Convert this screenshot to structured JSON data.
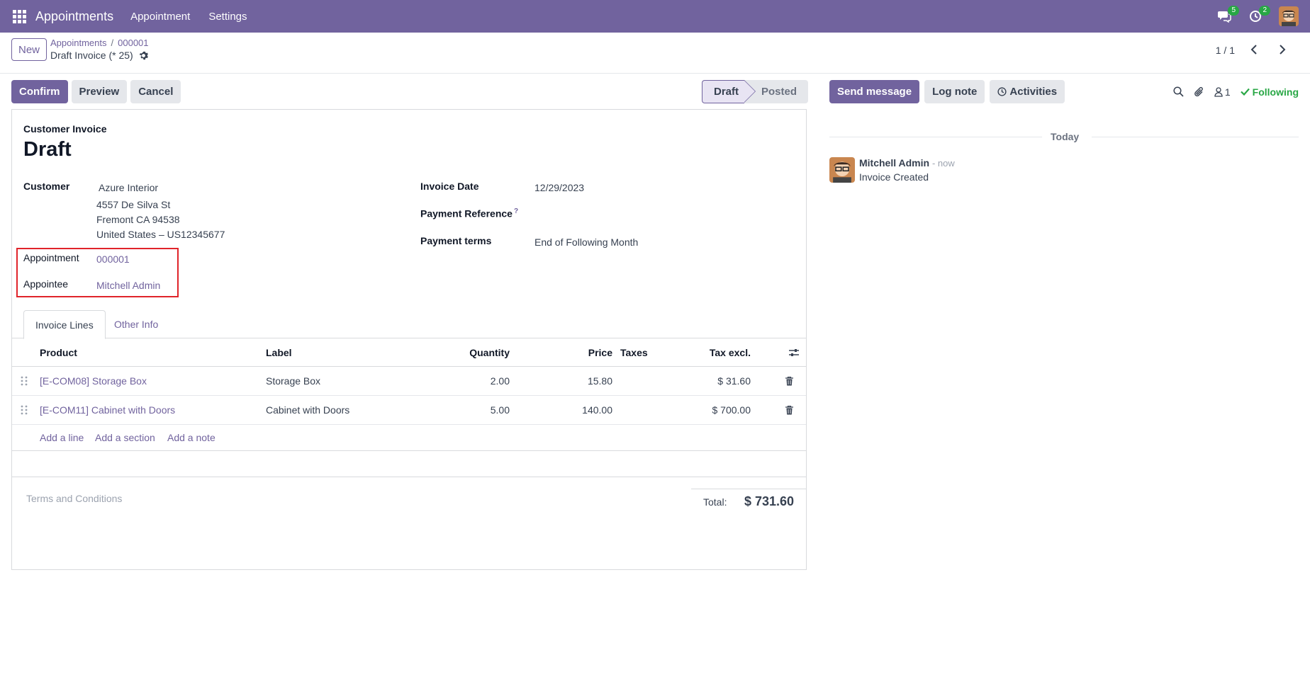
{
  "navbar": {
    "brand": "Appointments",
    "menu": [
      "Appointment",
      "Settings"
    ],
    "messages_badge": "5",
    "activities_badge": "2",
    "bg_color": "#71639e"
  },
  "control_panel": {
    "new_label": "New",
    "breadcrumb": [
      "Appointments",
      "000001"
    ],
    "record_title": "Draft Invoice (* 25)",
    "pager": "1 / 1"
  },
  "status_bar": {
    "buttons": [
      "Confirm",
      "Preview",
      "Cancel"
    ],
    "stages": [
      "Draft",
      "Posted"
    ]
  },
  "form": {
    "invoice_type": "Customer Invoice",
    "state": "Draft",
    "customer_label": "Customer",
    "customer_name": "Azure Interior",
    "customer_address": [
      "4557 De Silva St",
      "Fremont CA 94538",
      "United States – US12345677"
    ],
    "appointment_label": "Appointment",
    "appointment_value": "000001",
    "appointee_label": "Appointee",
    "appointee_value": "Mitchell Admin",
    "invoice_date_label": "Invoice Date",
    "invoice_date": "12/29/2023",
    "payment_ref_label": "Payment Reference",
    "payment_ref_help": "?",
    "payment_terms_label": "Payment terms",
    "payment_terms": "End of Following Month"
  },
  "tabs": [
    "Invoice Lines",
    "Other Info"
  ],
  "lines": {
    "headers": {
      "product": "Product",
      "label": "Label",
      "quantity": "Quantity",
      "price": "Price",
      "taxes": "Taxes",
      "tax_excl": "Tax excl."
    },
    "rows": [
      {
        "product": "[E-COM08] Storage Box",
        "label": "Storage Box",
        "quantity": "2.00",
        "price": "15.80",
        "taxes": "",
        "subtotal": "$ 31.60"
      },
      {
        "product": "[E-COM11] Cabinet with Doors",
        "label": "Cabinet with Doors",
        "quantity": "5.00",
        "price": "140.00",
        "taxes": "",
        "subtotal": "$ 700.00"
      }
    ],
    "add_actions": [
      "Add a line",
      "Add a section",
      "Add a note"
    ]
  },
  "footer": {
    "terms_placeholder": "Terms and Conditions",
    "total_label": "Total:",
    "total_value": "$ 731.60"
  },
  "chatter": {
    "send_message": "Send message",
    "log_note": "Log note",
    "activities": "Activities",
    "followers_count": "1",
    "following": "Following",
    "today": "Today",
    "message": {
      "author": "Mitchell Admin",
      "time": "- now",
      "body": "Invoice Created"
    }
  }
}
